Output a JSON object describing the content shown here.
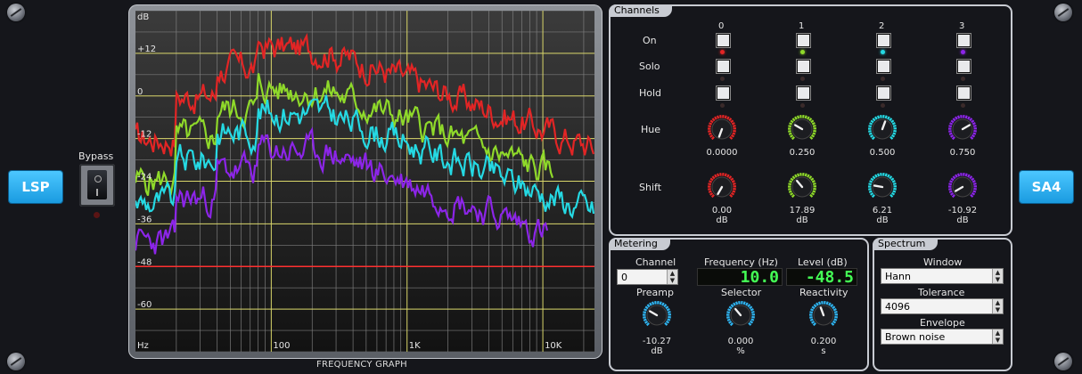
{
  "plugin": {
    "left_logo": "LSP",
    "right_logo": "SA4"
  },
  "bypass": {
    "label": "Bypass"
  },
  "graph": {
    "caption": "FREQUENCY GRAPH",
    "y_labels": [
      "dB",
      "+12",
      "0",
      "-12",
      "-24",
      "-36",
      "-48",
      "-60",
      "Hz"
    ],
    "x_labels": [
      "100",
      "1K",
      "10K"
    ]
  },
  "channels": {
    "title": "Channels",
    "row_labels": {
      "on": "On",
      "solo": "Solo",
      "hold": "Hold",
      "hue": "Hue",
      "shift": "Shift"
    },
    "items": [
      {
        "index": "0",
        "hue": "0.0000",
        "shift": "0.00",
        "unit": "dB",
        "color": "#e22525"
      },
      {
        "index": "1",
        "hue": "0.250",
        "shift": "17.89",
        "unit": "dB",
        "color": "#8fd92a"
      },
      {
        "index": "2",
        "hue": "0.500",
        "shift": "6.21",
        "unit": "dB",
        "color": "#25d9e3"
      },
      {
        "index": "3",
        "hue": "0.750",
        "shift": "-10.92",
        "unit": "dB",
        "color": "#8c25e8"
      }
    ]
  },
  "metering": {
    "title": "Metering",
    "channel_label": "Channel",
    "channel_value": "0",
    "frequency_label": "Frequency (Hz)",
    "frequency_value": "10.0",
    "level_label": "Level (dB)",
    "level_value": "-48.5",
    "preamp_label": "Preamp",
    "preamp_value": "-10.27",
    "preamp_unit": "dB",
    "selector_label": "Selector",
    "selector_value": "0.000",
    "selector_unit": "%",
    "reactivity_label": "Reactivity",
    "reactivity_value": "0.200",
    "reactivity_unit": "s"
  },
  "spectrum": {
    "title": "Spectrum",
    "window_label": "Window",
    "window_value": "Hann",
    "tolerance_label": "Tolerance",
    "tolerance_value": "4096",
    "envelope_label": "Envelope",
    "envelope_value": "Brown noise"
  },
  "colors": {
    "accent": "#2fb4f0",
    "panel_border": "#c8cbd2",
    "lcd_text": "#44ff55"
  }
}
